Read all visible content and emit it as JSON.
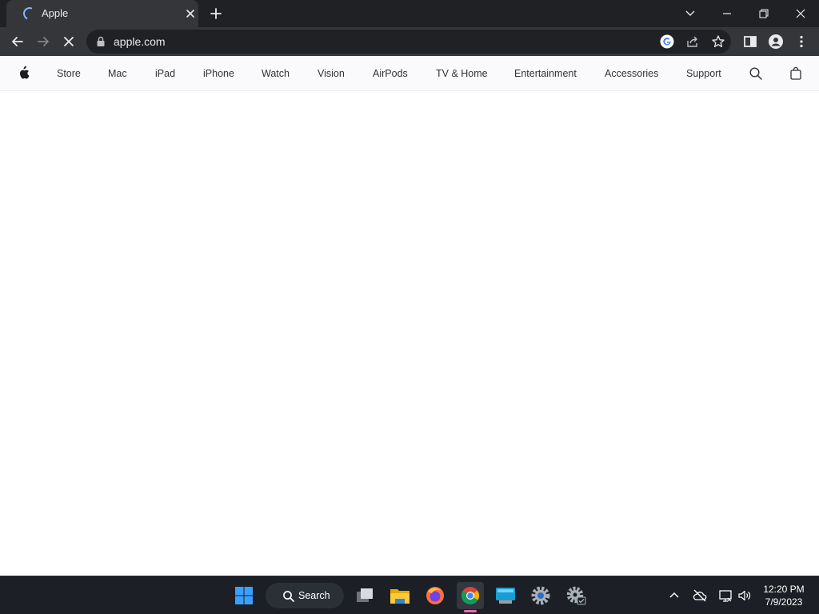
{
  "browser": {
    "tab_title": "Apple",
    "url": "apple.com"
  },
  "apple_nav": {
    "items": [
      "Store",
      "Mac",
      "iPad",
      "iPhone",
      "Watch",
      "Vision",
      "AirPods",
      "TV & Home",
      "Entertainment",
      "Accessories",
      "Support"
    ]
  },
  "taskbar": {
    "search_label": "Search",
    "time": "12:20 PM",
    "date": "7/9/2023"
  },
  "colors": {
    "titlebar": "#202124",
    "toolbar": "#35363a",
    "nav_background": "#fafafc",
    "taskbar": "#1c1f25",
    "loading_accent": "#8ab4f8"
  },
  "icons": {
    "tab": [
      "loading-spinner-icon",
      "close-icon",
      "plus-icon"
    ],
    "window": [
      "chevron-down-icon",
      "minimize-icon",
      "restore-icon",
      "close-icon"
    ],
    "toolbar": [
      "back-arrow-icon",
      "forward-arrow-icon",
      "stop-icon",
      "lock-icon",
      "google-icon",
      "share-icon",
      "star-icon",
      "side-panel-icon",
      "profile-icon",
      "kebab-menu-icon"
    ],
    "nav": [
      "apple-logo-icon",
      "search-icon",
      "bag-icon"
    ],
    "taskbar": [
      "windows-start-icon",
      "search-icon",
      "task-view-icon",
      "file-explorer-icon",
      "firefox-icon",
      "chrome-icon",
      "display-app-icon",
      "settings-icon",
      "settings-check-icon",
      "chevron-up-icon",
      "cloud-off-icon",
      "network-icon",
      "volume-icon"
    ]
  }
}
